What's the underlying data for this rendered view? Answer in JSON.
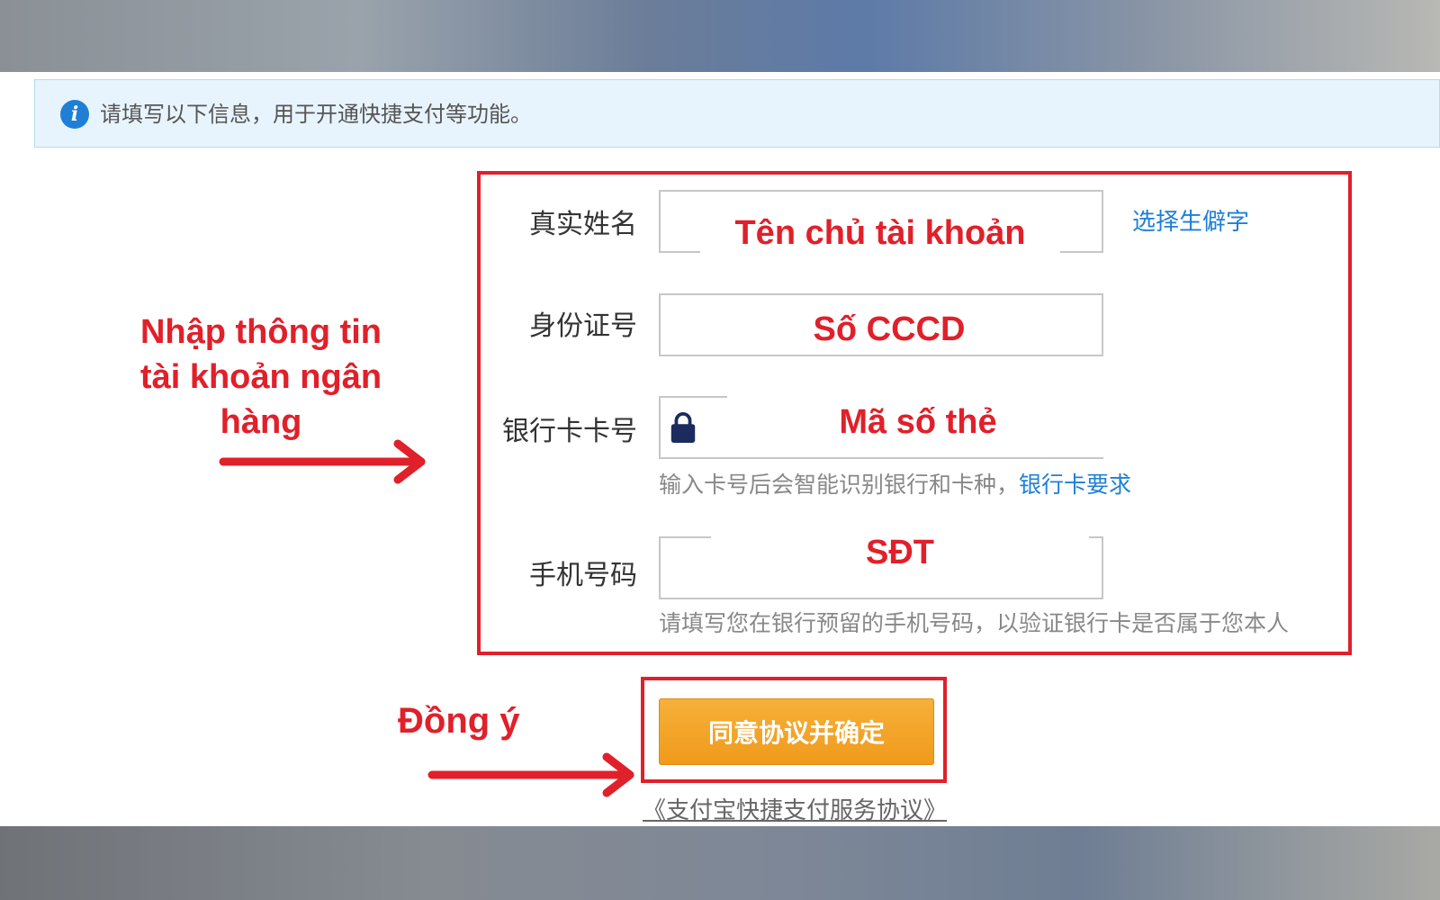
{
  "info_bar": {
    "text": "请填写以下信息，用于开通快捷支付等功能。"
  },
  "form": {
    "name": {
      "label": "真实姓名",
      "overlay": "Tên chủ tài khoản",
      "link": "选择生僻字"
    },
    "id_number": {
      "label": "身份证号",
      "overlay": "Số CCCD"
    },
    "card_number": {
      "label": "银行卡卡号",
      "overlay": "Mã số thẻ",
      "hint": "输入卡号后会智能识别银行和卡种，",
      "hint_link": "银行卡要求"
    },
    "phone": {
      "label": "手机号码",
      "overlay": "SĐT",
      "hint": "请填写您在银行预留的手机号码，以验证银行卡是否属于您本人"
    }
  },
  "confirm_button": "同意协议并确定",
  "agreement_link": "《支付宝快捷支付服务协议》",
  "annotations": {
    "enter_info_line1": "Nhập thông tin",
    "enter_info_line2": "tài khoản ngân",
    "enter_info_line3": "hàng",
    "agree": "Đồng ý"
  },
  "colors": {
    "annotation_red": "#e0202a",
    "link_blue": "#1f7fd6",
    "button_orange": "#f09a1a",
    "info_bar_bg": "#e8f4fd"
  },
  "icons": {
    "info": "info-icon",
    "lock": "lock-icon",
    "arrow": "arrow-right-icon"
  }
}
